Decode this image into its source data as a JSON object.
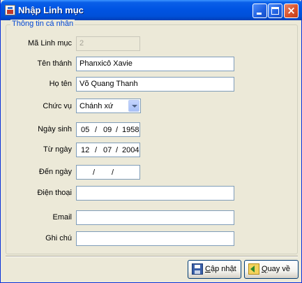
{
  "window": {
    "title": "Nhập Linh mục",
    "minimize_symbol": "",
    "maximize_symbol": "",
    "close_symbol": "×"
  },
  "group": {
    "legend": "Thông tin cá nhân"
  },
  "fields": {
    "ma_linh_muc": {
      "label": "Mã Linh mục",
      "value": "2"
    },
    "ten_thanh": {
      "label": "Tên thánh",
      "value": "Phanxicô Xavie"
    },
    "ho_ten": {
      "label": "Họ tên",
      "value": "Võ Quang Thanh"
    },
    "chuc_vu": {
      "label": "Chức vụ",
      "value": "Chánh xứ"
    },
    "ngay_sinh": {
      "label": "Ngày sinh",
      "day": "05",
      "month": "09",
      "year": "1958"
    },
    "tu_ngay": {
      "label": "Từ ngày",
      "day": "12",
      "month": "07",
      "year": "2004"
    },
    "den_ngay": {
      "label": "Đến ngày",
      "day": "",
      "month": "",
      "year": ""
    },
    "dien_thoai": {
      "label": "Điện thoại",
      "value": ""
    },
    "email": {
      "label": "Email",
      "value": ""
    },
    "ghi_chu": {
      "label": "Ghi chú",
      "value": ""
    }
  },
  "date_separator": "/",
  "buttons": {
    "save_label_first": "C",
    "save_label_rest": "ập nhật",
    "back_label_first": "Q",
    "back_label_rest": "uay về"
  },
  "colors": {
    "titlebar": "#0054e3",
    "legend_text": "#0046d5",
    "input_border": "#7f9db9",
    "window_bg": "#ece9d8"
  },
  "icons": {
    "app": "app-icon",
    "save": "floppy-disk-icon",
    "back": "folder-back-icon",
    "dropdown": "chevron-down-icon"
  }
}
